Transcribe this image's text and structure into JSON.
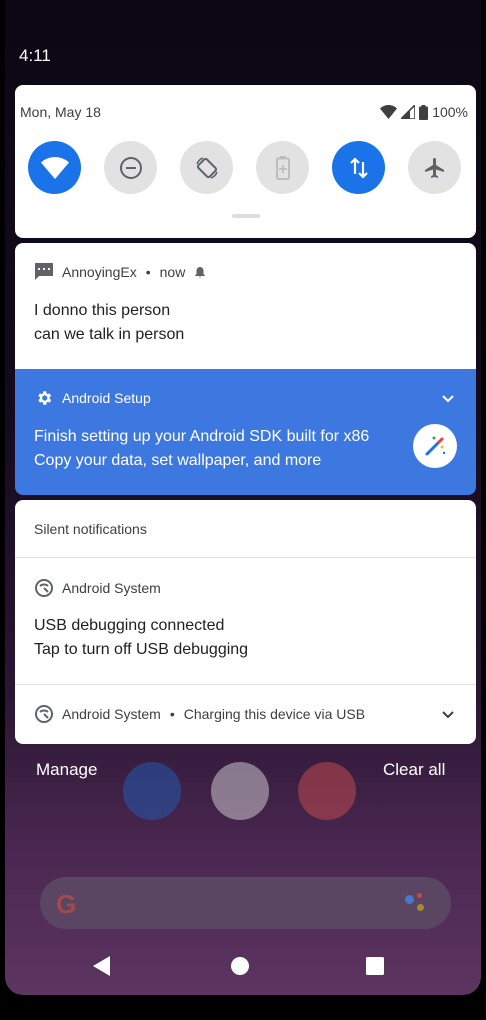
{
  "status": {
    "time": "4:11"
  },
  "quick_settings": {
    "date": "Mon, May 18",
    "battery": "100%",
    "tiles": [
      {
        "name": "wifi",
        "state": "on"
      },
      {
        "name": "do-not-disturb",
        "state": "off"
      },
      {
        "name": "auto-rotate",
        "state": "off"
      },
      {
        "name": "battery-saver",
        "state": "off"
      },
      {
        "name": "mobile-data",
        "state": "on"
      },
      {
        "name": "airplane-mode",
        "state": "off"
      }
    ]
  },
  "notifications": {
    "message": {
      "app": "AnnoyingEx",
      "time": "now",
      "line1": "I donno this person",
      "line2": "can we talk in person"
    },
    "setup": {
      "app": "Android Setup",
      "line1": "Finish setting up your Android SDK built for x86",
      "line2": "Copy your data, set wallpaper, and more"
    },
    "silent_header": "Silent notifications",
    "usb": {
      "app": "Android System",
      "line1": "USB debugging connected",
      "line2": "Tap to turn off USB debugging"
    },
    "charging": {
      "app": "Android System",
      "text": "Charging this device via USB"
    }
  },
  "actions": {
    "manage": "Manage",
    "clear_all": "Clear all"
  },
  "colors": {
    "accent": "#1a73e8",
    "setup_bg": "#3c78e0"
  }
}
